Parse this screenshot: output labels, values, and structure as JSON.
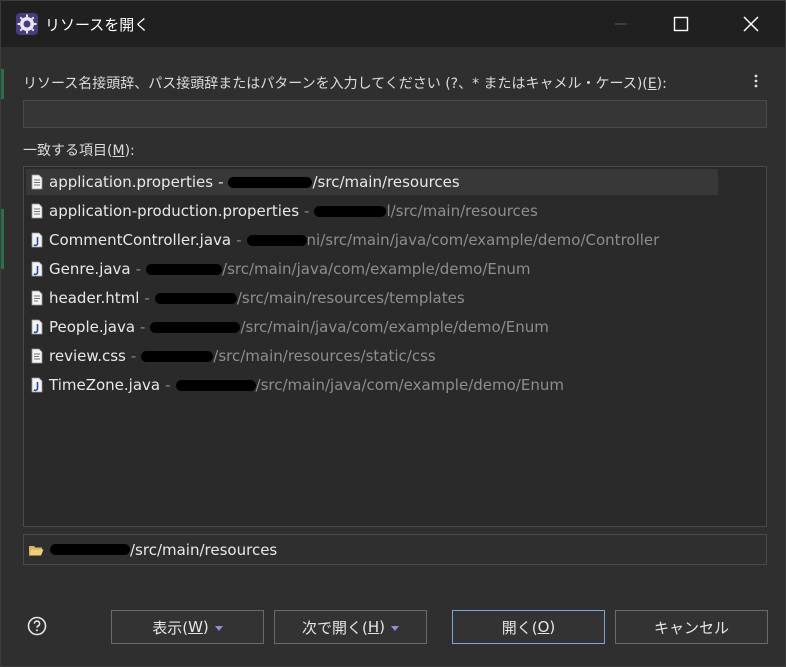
{
  "window": {
    "title": "リソースを開く",
    "min_symbol": "—",
    "icons": {
      "app": "eclipse-icon",
      "minimize": "minimize-icon",
      "maximize": "maximize-icon",
      "close": "close-icon"
    }
  },
  "prompt": {
    "label": "リソース名接頭辞、パス接頭辞またはパターンを入力してください (?、* またはキャメル・ケース)(",
    "mnemonic": "E",
    "suffix": "):",
    "value": ""
  },
  "matches": {
    "label": "一致する項目(",
    "mnemonic": "M",
    "suffix": "):",
    "items": [
      {
        "name": "application.properties",
        "sep": "-",
        "path_visible": "/src/main/resources",
        "icon": "properties-file-icon",
        "selected": true
      },
      {
        "name": "application-production.properties",
        "sep": "-",
        "path_visible": "l/src/main/resources",
        "icon": "properties-file-icon",
        "selected": false
      },
      {
        "name": "CommentController.java",
        "sep": "-",
        "path_visible": "ni/src/main/java/com/example/demo/Controller",
        "icon": "java-file-icon",
        "selected": false
      },
      {
        "name": "Genre.java",
        "sep": "-",
        "path_visible": "/src/main/java/com/example/demo/Enum",
        "icon": "java-file-icon",
        "selected": false
      },
      {
        "name": "header.html",
        "sep": "-",
        "path_visible": "/src/main/resources/templates",
        "icon": "html-file-icon",
        "selected": false
      },
      {
        "name": "People.java",
        "sep": "-",
        "path_visible": "/src/main/java/com/example/demo/Enum",
        "icon": "java-file-icon",
        "selected": false
      },
      {
        "name": "review.css",
        "sep": "-",
        "path_visible": "/src/main/resources/static/css",
        "icon": "css-file-icon",
        "selected": false
      },
      {
        "name": "TimeZone.java",
        "sep": "-",
        "path_visible": "/src/main/java/com/example/demo/Enum",
        "icon": "java-file-icon",
        "selected": false
      }
    ]
  },
  "folder": {
    "path_visible": "/src/main/resources",
    "icon": "folder-open-icon"
  },
  "buttons": {
    "show": {
      "label": "表示(",
      "mnemonic": "W",
      "suffix": ")"
    },
    "open_with": {
      "label": "次で開く(",
      "mnemonic": "H",
      "suffix": ")"
    },
    "open": {
      "label": "開く(",
      "mnemonic": "O",
      "suffix": ")"
    },
    "cancel": {
      "label": "キャンセル"
    }
  },
  "help": {
    "icon": "help-icon"
  },
  "colors": {
    "titlebar": "#202020",
    "background": "#2f2f2f",
    "list_background": "#2a2a2a",
    "selected_row": "#383838",
    "path_text": "#8e8e8e",
    "default_button_border": "#7aa7d8",
    "dropdown_caret": "#9b87d8"
  }
}
